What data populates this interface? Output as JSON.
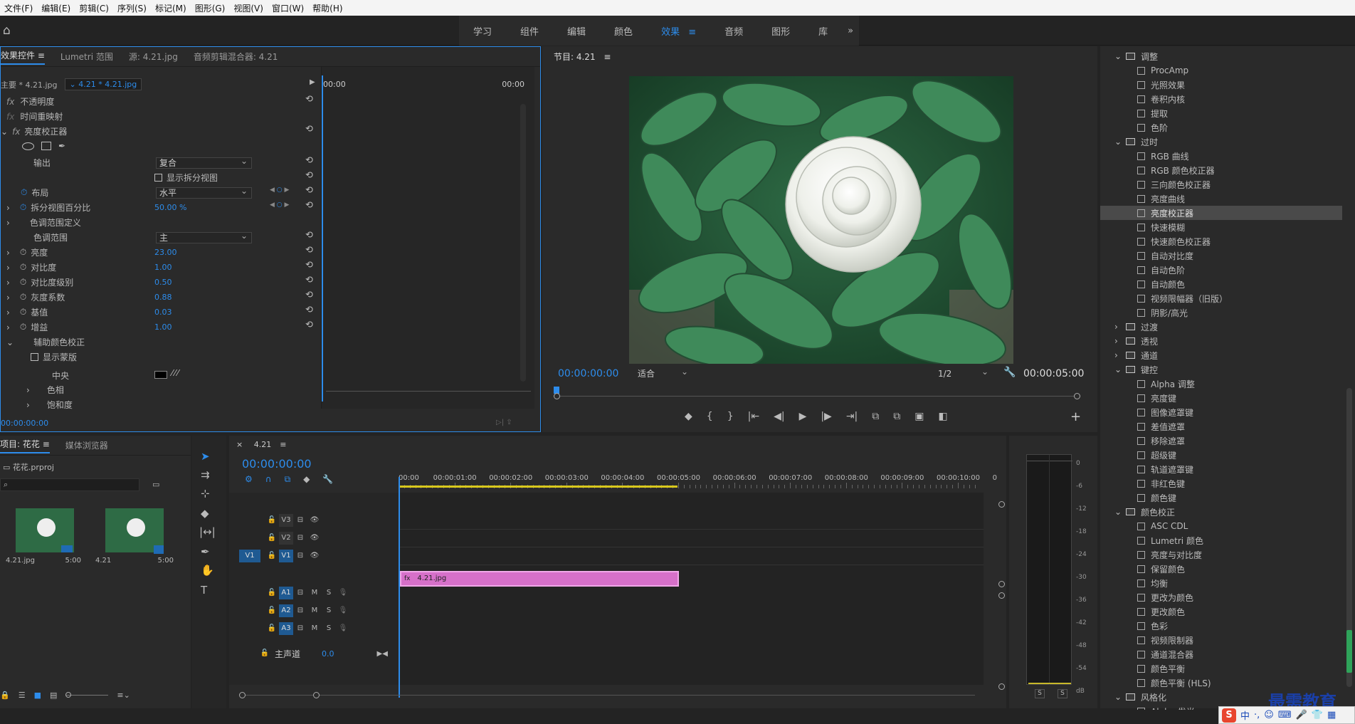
{
  "menu": [
    "文件(F)",
    "编辑(E)",
    "剪辑(C)",
    "序列(S)",
    "标记(M)",
    "图形(G)",
    "视图(V)",
    "窗口(W)",
    "帮助(H)"
  ],
  "workspaces": {
    "tabs": [
      "学习",
      "组件",
      "编辑",
      "颜色",
      "效果",
      "音频",
      "图形",
      "库"
    ],
    "active": "效果",
    "more": "»"
  },
  "effect_controls": {
    "tabs": [
      "效果控件",
      "Lumetri 范围",
      "源: 4.21.jpg",
      "音频剪辑混合器: 4.21"
    ],
    "master": "主要 * 4.21.jpg",
    "clip": "4.21 * 4.21.jpg",
    "tc_start": "00:00",
    "tc_end": "00:00",
    "opacity": "不透明度",
    "timeremap": "时间重映射",
    "corrector": "亮度校正器",
    "output_label": "输出",
    "output_value": "复合",
    "split_view": "显示拆分视图",
    "layout_label": "布局",
    "layout_value": "水平",
    "split_pct_label": "拆分视图百分比",
    "split_pct_value": "50.00 %",
    "range_def": "色调范围定义",
    "range_label": "色调范围",
    "range_value": "主",
    "params": [
      {
        "label": "亮度",
        "value": "23.00"
      },
      {
        "label": "对比度",
        "value": "1.00"
      },
      {
        "label": "对比度级别",
        "value": "0.50"
      },
      {
        "label": "灰度系数",
        "value": "0.88"
      },
      {
        "label": "基值",
        "value": "0.03"
      },
      {
        "label": "增益",
        "value": "1.00"
      }
    ],
    "secondary": "辅助颜色校正",
    "show_mask": "显示蒙版",
    "center": "中央",
    "hue": "色相",
    "saturation": "饱和度",
    "footer_tc": "00:00:00:00"
  },
  "program": {
    "title": "节目: 4.21",
    "tc": "00:00:00:00",
    "fit": "适合",
    "res": "1/2",
    "duration": "00:00:05:00"
  },
  "effects_tree": {
    "items": [
      {
        "t": "folder",
        "label": "调整",
        "open": true
      },
      {
        "t": "fx",
        "label": "ProcAmp"
      },
      {
        "t": "fx",
        "label": "光照效果"
      },
      {
        "t": "fx",
        "label": "卷积内核"
      },
      {
        "t": "fx",
        "label": "提取"
      },
      {
        "t": "fx",
        "label": "色阶"
      },
      {
        "t": "folder",
        "label": "过时",
        "open": true
      },
      {
        "t": "fx",
        "label": "RGB 曲线"
      },
      {
        "t": "fx",
        "label": "RGB 颜色校正器"
      },
      {
        "t": "fx",
        "label": "三向颜色校正器"
      },
      {
        "t": "fx",
        "label": "亮度曲线"
      },
      {
        "t": "fx",
        "label": "亮度校正器",
        "sel": true
      },
      {
        "t": "fx",
        "label": "快速模糊"
      },
      {
        "t": "fx",
        "label": "快速颜色校正器"
      },
      {
        "t": "fx",
        "label": "自动对比度"
      },
      {
        "t": "fx",
        "label": "自动色阶"
      },
      {
        "t": "fx",
        "label": "自动颜色"
      },
      {
        "t": "fx",
        "label": "视频限幅器（旧版）"
      },
      {
        "t": "fx",
        "label": "阴影/高光"
      },
      {
        "t": "folder",
        "label": "过渡",
        "open": false
      },
      {
        "t": "folder",
        "label": "透视",
        "open": false
      },
      {
        "t": "folder",
        "label": "通道",
        "open": false
      },
      {
        "t": "folder",
        "label": "键控",
        "open": true
      },
      {
        "t": "fx",
        "label": "Alpha 调整"
      },
      {
        "t": "fx",
        "label": "亮度键"
      },
      {
        "t": "fx",
        "label": "图像遮罩键"
      },
      {
        "t": "fx",
        "label": "差值遮罩"
      },
      {
        "t": "fx",
        "label": "移除遮罩"
      },
      {
        "t": "fx",
        "label": "超级键"
      },
      {
        "t": "fx",
        "label": "轨道遮罩键"
      },
      {
        "t": "fx",
        "label": "非红色键"
      },
      {
        "t": "fx",
        "label": "颜色键"
      },
      {
        "t": "folder",
        "label": "颜色校正",
        "open": true
      },
      {
        "t": "fx",
        "label": "ASC CDL"
      },
      {
        "t": "fx",
        "label": "Lumetri 颜色"
      },
      {
        "t": "fx",
        "label": "亮度与对比度"
      },
      {
        "t": "fx",
        "label": "保留颜色"
      },
      {
        "t": "fx",
        "label": "均衡"
      },
      {
        "t": "fx",
        "label": "更改为颜色"
      },
      {
        "t": "fx",
        "label": "更改颜色"
      },
      {
        "t": "fx",
        "label": "色彩"
      },
      {
        "t": "fx",
        "label": "视频限制器"
      },
      {
        "t": "fx",
        "label": "通道混合器"
      },
      {
        "t": "fx",
        "label": "颜色平衡"
      },
      {
        "t": "fx",
        "label": "颜色平衡 (HLS)"
      },
      {
        "t": "folder",
        "label": "风格化",
        "open": true
      },
      {
        "t": "fx",
        "label": "Alpha 发光"
      }
    ]
  },
  "project": {
    "tabs": [
      "项目: 花花",
      "媒体浏览器"
    ],
    "file": "花花.prproj",
    "items": [
      {
        "name": "4.21.jpg",
        "dur": "5:00"
      },
      {
        "name": "4.21",
        "dur": "5:00"
      }
    ]
  },
  "timeline": {
    "seq": "4.21",
    "tc": "00:00:00:00",
    "ruler": [
      "00:00",
      "00:00:01:00",
      "00:00:02:00",
      "00:00:03:00",
      "00:00:04:00",
      "00:00:05:00",
      "00:00:06:00",
      "00:00:07:00",
      "00:00:08:00",
      "00:00:09:00",
      "00:00:10:00",
      "0"
    ],
    "video_tracks": [
      "V3",
      "V2",
      "V1"
    ],
    "source_v": "V1",
    "audio_tracks": [
      "A1",
      "A2",
      "A3"
    ],
    "master_label": "主声道",
    "master_value": "0.0",
    "clip": "4.21.jpg",
    "m": "M",
    "s": "S"
  },
  "meter": {
    "scale": [
      "0",
      "-6",
      "-12",
      "-18",
      "-24",
      "-30",
      "-36",
      "-42",
      "-48",
      "-54",
      "dB"
    ],
    "solo": [
      "S",
      "S"
    ]
  },
  "watermark": "最需教育",
  "ime": [
    "中",
    "·,"
  ],
  "colors": {
    "accent": "#2d8ceb",
    "clip": "#d670c9",
    "panel": "#2a2a2a"
  }
}
